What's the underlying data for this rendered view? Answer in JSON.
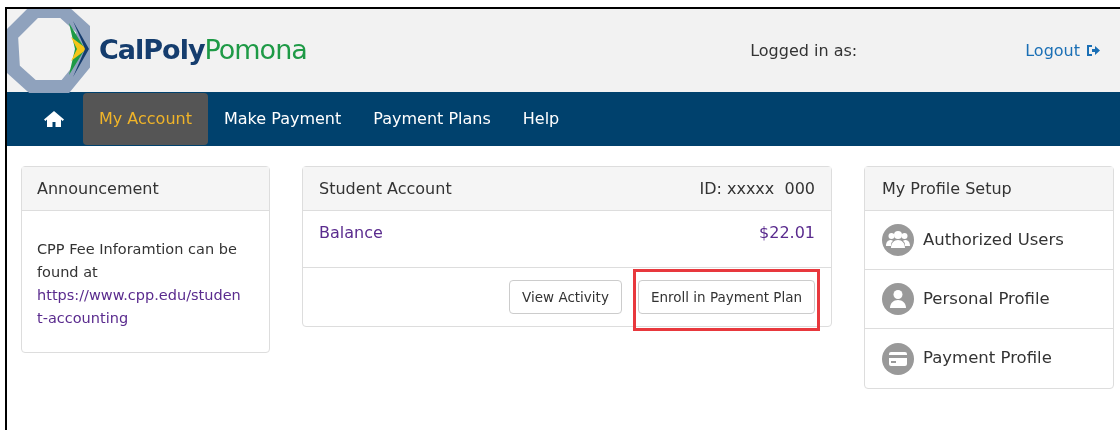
{
  "header": {
    "logo": {
      "part_1": "CalPoly",
      "part_2": "Pomona"
    },
    "logged_in_label": "Logged in as:",
    "logout": "Logout"
  },
  "nav": {
    "items": [
      {
        "kind": "home",
        "selected": false
      },
      {
        "kind": "text",
        "label": "My Account",
        "selected": true
      },
      {
        "kind": "text",
        "label": "Make Payment",
        "selected": false
      },
      {
        "kind": "text",
        "label": "Payment Plans",
        "selected": false
      },
      {
        "kind": "text",
        "label": "Help",
        "selected": false
      }
    ]
  },
  "announcement": {
    "title": "Announcement",
    "text": "CPP Fee Inforamtion can be found at",
    "link_line_1": "https://www.cpp.edu/studen",
    "link_line_2": "t-accounting"
  },
  "student_account": {
    "title": "Student Account",
    "id": "ID: xxxxx  000",
    "balance_label": "Balance",
    "balance": "$22.01",
    "buttons": [
      {
        "label": "View Activity",
        "highlighted": false
      },
      {
        "label": "Enroll in Payment Plan",
        "highlighted": true
      }
    ]
  },
  "profile_setup": {
    "title": "My Profile Setup",
    "items": [
      {
        "kind": "users",
        "label": "Authorized Users"
      },
      {
        "kind": "person",
        "label": "Personal Profile"
      },
      {
        "kind": "card",
        "label": "Payment Profile"
      }
    ]
  }
}
